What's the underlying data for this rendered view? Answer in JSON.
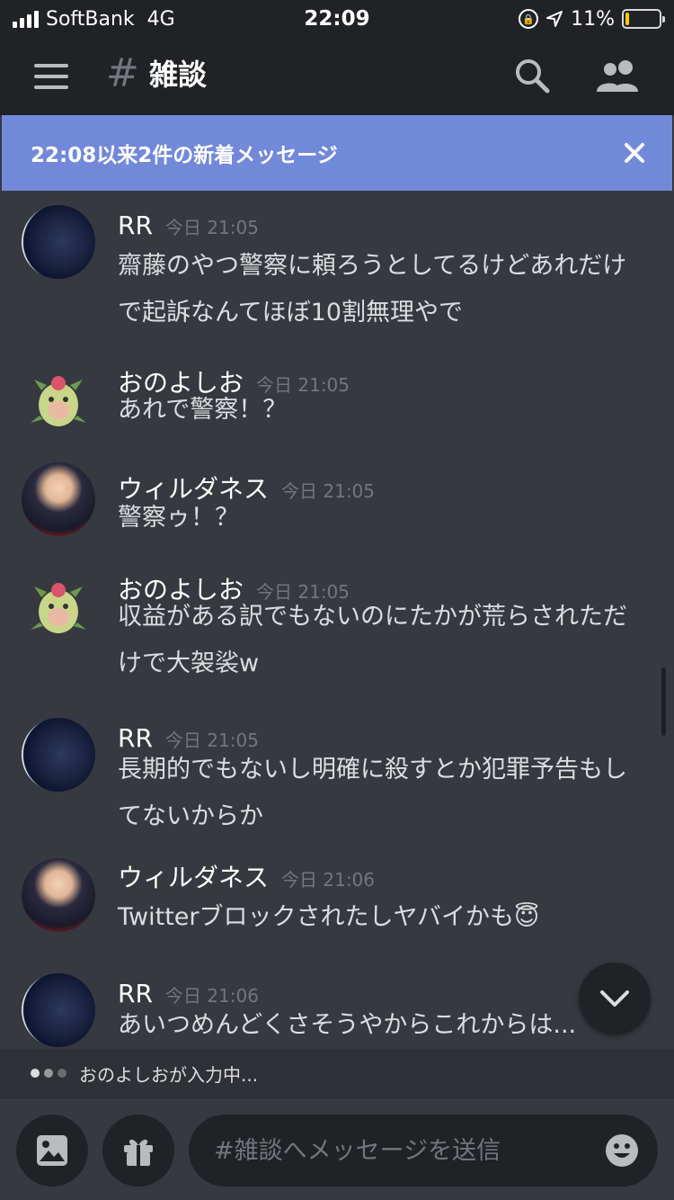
{
  "status_bar": {
    "carrier": "SoftBank",
    "network": "4G",
    "time": "22:09",
    "battery_text": "11%",
    "battery_level": 0.11
  },
  "header": {
    "hash_symbol": "#",
    "channel_name": "雑談"
  },
  "new_messages_bar": {
    "text": "22:08以来2件の新着メッセージ"
  },
  "messages": [
    {
      "author": "RR",
      "time": "今日 21:05",
      "text": "齋藤のやつ警察に頼ろうとしてるけどあれだけで起訴なんてほぼ10割無理やで",
      "avatar": "rr"
    },
    {
      "author": "おのよしお",
      "time": "今日 21:05",
      "text": "あれで警察！？",
      "avatar": "ono"
    },
    {
      "author": "ウィルダネス",
      "time": "今日 21:05",
      "text": "警察ゥ！？",
      "avatar": "wild"
    },
    {
      "author": "おのよしお",
      "time": "今日 21:05",
      "text": "収益がある訳でもないのにたかが荒らされただけで大袈裟w",
      "avatar": "ono"
    },
    {
      "author": "RR",
      "time": "今日 21:05",
      "text": "長期的でもないし明確に殺すとか犯罪予告もしてないからか",
      "avatar": "rr"
    },
    {
      "author": "ウィルダネス",
      "time": "今日 21:06",
      "text": "Twitterブロックされたしヤバイかも",
      "emoji": "😇",
      "avatar": "wild"
    },
    {
      "author": "RR",
      "time": "今日 21:06",
      "text": "あいつめんどくさそうやからこれからは...",
      "avatar": "rr"
    }
  ],
  "typing": {
    "text": "おのよしおが入力中..."
  },
  "composer": {
    "placeholder": "#雑談へメッセージを送信"
  },
  "colors": {
    "background": "#36393f",
    "header": "#202225",
    "accent": "#7289da",
    "muted": "#72767d"
  }
}
